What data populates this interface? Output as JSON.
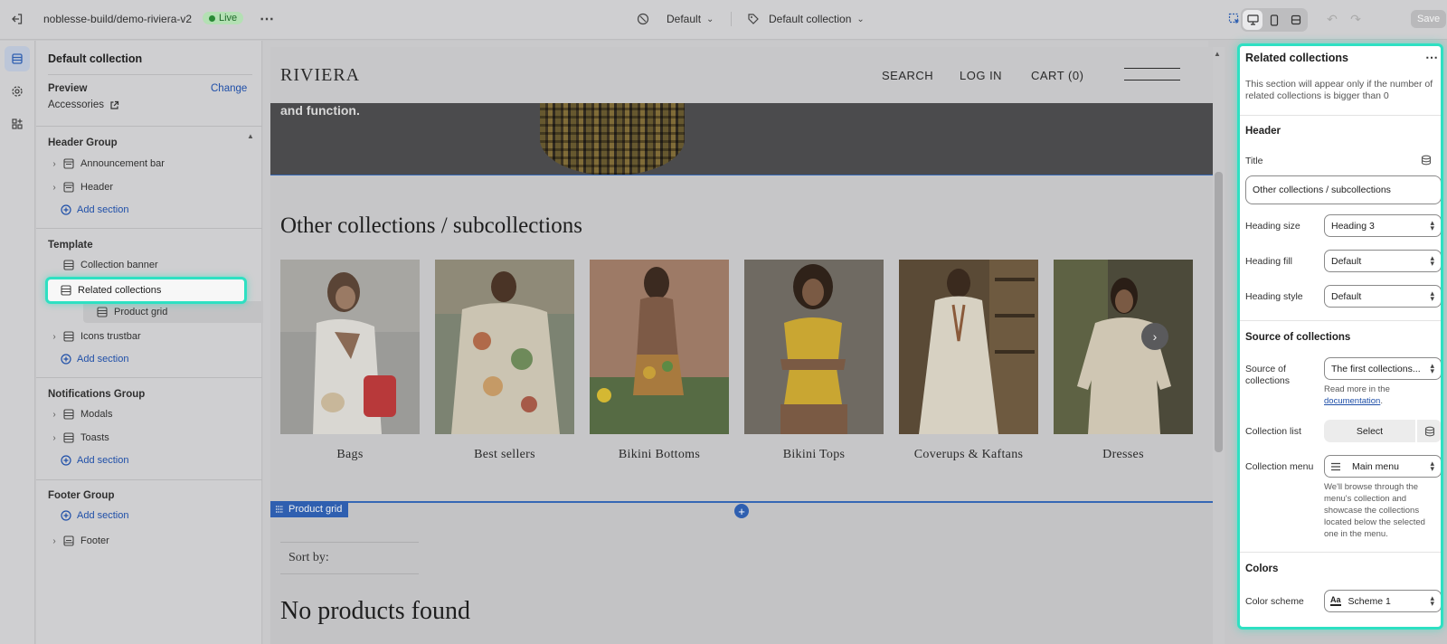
{
  "topbar": {
    "store_path": "noblesse-build/demo-riviera-v2",
    "live_label": "Live",
    "theme_select": "Default",
    "template_select": "Default collection",
    "save_label": "Save"
  },
  "sidebar": {
    "title": "Default collection",
    "preview_label": "Preview",
    "change_label": "Change",
    "preview_value": "Accessories",
    "header_group": {
      "title": "Header Group",
      "items": [
        "Announcement bar",
        "Header"
      ],
      "add_label": "Add section"
    },
    "template": {
      "title": "Template",
      "items": [
        "Collection banner",
        "Related collections",
        "Product grid",
        "Icons trustbar"
      ],
      "add_label": "Add section"
    },
    "notifications_group": {
      "title": "Notifications Group",
      "items": [
        "Modals",
        "Toasts"
      ],
      "add_label": "Add section"
    },
    "footer_group": {
      "title": "Footer Group",
      "add_label": "Add section",
      "items": [
        "Footer"
      ]
    }
  },
  "preview": {
    "logo": "RIVIERA",
    "nav": [
      "SEARCH",
      "LOG IN",
      "CART (0)"
    ],
    "banner_text": "and function.",
    "section_title": "Other collections / subcollections",
    "collections": [
      "Bags",
      "Best sellers",
      "Bikini Bottoms",
      "Bikini Tops",
      "Coverups & Kaftans",
      "Dresses"
    ],
    "product_grid_tag": "Product grid",
    "sort_by": "Sort by:",
    "no_products": "No products found"
  },
  "panel": {
    "title": "Related collections",
    "description": "This section will appear only if the number of related collections is bigger than 0",
    "header_heading": "Header",
    "title_label": "Title",
    "title_value": "Other collections / subcollections",
    "heading_size_label": "Heading size",
    "heading_size_value": "Heading 3",
    "heading_fill_label": "Heading fill",
    "heading_fill_value": "Default",
    "heading_style_label": "Heading style",
    "heading_style_value": "Default",
    "source_heading": "Source of collections",
    "source_label": "Source of collections",
    "source_value": "The first collections...",
    "source_help_prefix": "Read more in the",
    "source_help_link": "documentation",
    "collection_list_label": "Collection list",
    "select_label": "Select",
    "collection_menu_label": "Collection menu",
    "collection_menu_value": "Main menu",
    "menu_help": "We'll browse through the menu's collection and showcase the collections located below the selected one in the menu.",
    "colors_heading": "Colors",
    "color_scheme_label": "Color scheme",
    "color_scheme_value": "Scheme 1"
  },
  "colors": {
    "highlight": "#2ee0c2",
    "link": "#1f4fa8",
    "selection_outline": "#3567b5"
  }
}
